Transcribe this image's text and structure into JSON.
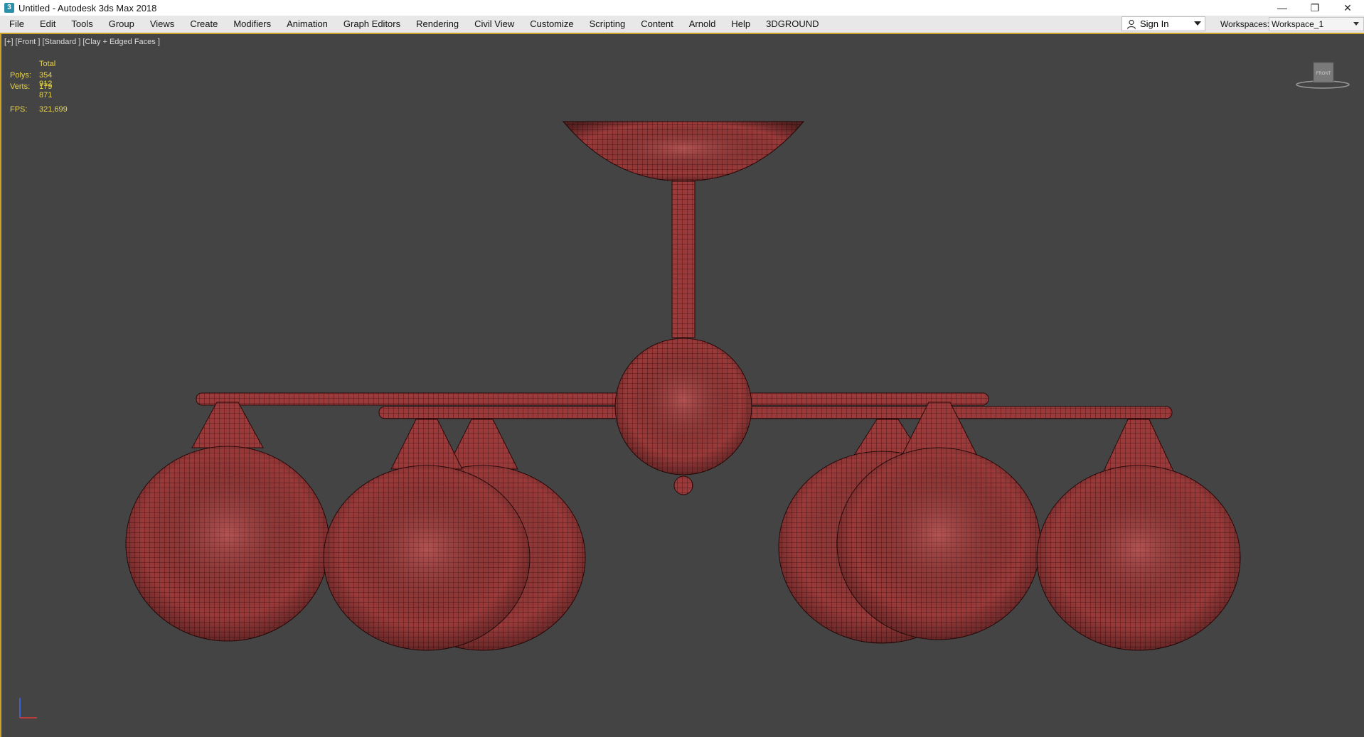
{
  "window": {
    "title": "Untitled - Autodesk 3ds Max 2018",
    "app_icon": "3ds-max-icon",
    "buttons": [
      "minimize-icon",
      "restore-icon",
      "close-icon"
    ]
  },
  "menu": {
    "items": [
      "File",
      "Edit",
      "Tools",
      "Group",
      "Views",
      "Create",
      "Modifiers",
      "Animation",
      "Graph Editors",
      "Rendering",
      "Civil View",
      "Customize",
      "Scripting",
      "Content",
      "Arnold",
      "Help",
      "3DGROUND"
    ]
  },
  "signin": {
    "label": "Sign In"
  },
  "workspaces": {
    "label": "Workspaces:",
    "value": "Workspace_1"
  },
  "viewport": {
    "label": "[+] [Front ] [Standard ] [Clay + Edged Faces ]",
    "stats": {
      "header": "Total",
      "polys_label": "Polys:",
      "polys": "354 912",
      "verts_label": "Verts:",
      "verts": "179 871",
      "fps_label": "FPS:",
      "fps": "321,699"
    },
    "viewcube_label": "FRONT"
  },
  "colors": {
    "accent": "#c9a227",
    "viewport_bg": "#444444",
    "model": "#9a3a3a",
    "stats_text": "#e8d44a"
  }
}
